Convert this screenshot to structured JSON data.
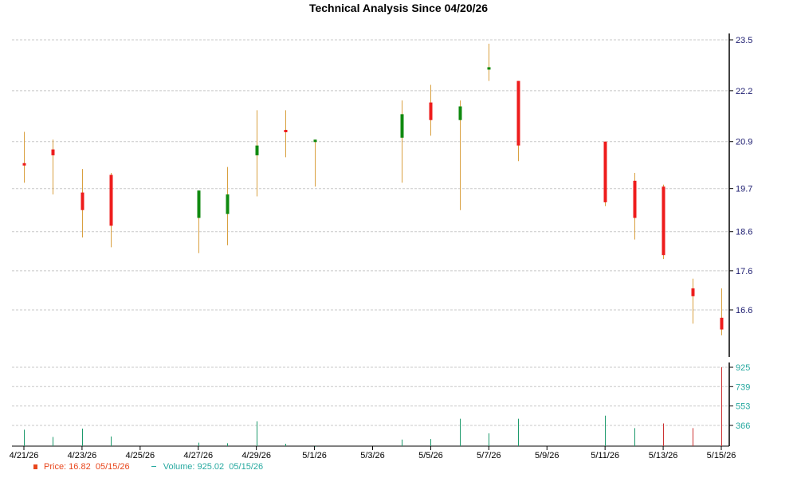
{
  "chart_data": {
    "type": "candlestick",
    "title": "Technical Analysis Since 04/20/26",
    "price_axis": {
      "ticks": [
        "23.5",
        "22.2",
        "20.9",
        "19.7",
        "18.6",
        "17.6",
        "16.6"
      ],
      "range": [
        15.8,
        23.5
      ]
    },
    "volume_axis": {
      "ticks": [
        "925",
        "739",
        "553",
        "366"
      ],
      "range": [
        160,
        925
      ]
    },
    "date_ticks": [
      "4/21/26",
      "4/23/26",
      "4/25/26",
      "4/27/26",
      "4/29/26",
      "5/1/26",
      "5/3/26",
      "5/5/26",
      "5/7/26",
      "5/9/26",
      "5/11/26",
      "5/13/26",
      "5/15/26"
    ],
    "colors": {
      "up": "#108a10",
      "down": "#ee1c1c",
      "wick": "#d9a040",
      "volume_up": "#1d9a6c",
      "volume_down": "#cc3333",
      "grid": "#c8c8c8",
      "axis": "#000000",
      "price_tick_text": "#1a1a6e",
      "volume_tick_text": "#27a9a0"
    },
    "grid": true,
    "candles": [
      {
        "date": "2026-04-21",
        "open": 20.35,
        "high": 21.15,
        "low": 19.85,
        "close": 20.3,
        "volume": 325
      },
      {
        "date": "2026-04-22",
        "open": 20.7,
        "high": 20.95,
        "low": 19.55,
        "close": 20.55,
        "volume": 255
      },
      {
        "date": "2026-04-23",
        "open": 19.6,
        "high": 20.2,
        "low": 18.45,
        "close": 19.15,
        "volume": 335
      },
      {
        "date": "2026-04-24",
        "open": 20.05,
        "high": 20.1,
        "low": 18.2,
        "close": 18.75,
        "volume": 260
      },
      {
        "date": "2026-04-27",
        "open": 18.95,
        "high": 19.65,
        "low": 18.05,
        "close": 19.65,
        "volume": 200
      },
      {
        "date": "2026-04-28",
        "open": 19.05,
        "high": 20.25,
        "low": 18.25,
        "close": 19.55,
        "volume": 195
      },
      {
        "date": "2026-04-29",
        "open": 20.55,
        "high": 21.7,
        "low": 19.5,
        "close": 20.8,
        "volume": 405
      },
      {
        "date": "2026-04-30",
        "open": 21.2,
        "high": 21.7,
        "low": 20.5,
        "close": 21.15,
        "volume": 190
      },
      {
        "date": "2026-05-01",
        "open": 20.95,
        "high": 20.95,
        "low": 19.75,
        "close": 20.95,
        "volume": 160
      },
      {
        "date": "2026-05-04",
        "open": 21.0,
        "high": 21.95,
        "low": 19.85,
        "close": 21.6,
        "volume": 230
      },
      {
        "date": "2026-05-05",
        "open": 21.9,
        "high": 22.35,
        "low": 21.05,
        "close": 21.45,
        "volume": 235
      },
      {
        "date": "2026-05-06",
        "open": 21.45,
        "high": 21.95,
        "low": 19.15,
        "close": 21.8,
        "volume": 430
      },
      {
        "date": "2026-05-07",
        "open": 22.75,
        "high": 23.4,
        "low": 22.45,
        "close": 22.8,
        "volume": 290
      },
      {
        "date": "2026-05-08",
        "open": 22.45,
        "high": 22.45,
        "low": 20.4,
        "close": 20.8,
        "volume": 430
      },
      {
        "date": "2026-05-11",
        "open": 20.9,
        "high": 20.9,
        "low": 19.25,
        "close": 19.35,
        "volume": 460
      },
      {
        "date": "2026-05-12",
        "open": 19.9,
        "high": 20.1,
        "low": 18.4,
        "close": 18.95,
        "volume": 340
      },
      {
        "date": "2026-05-13",
        "open": 19.75,
        "high": 19.8,
        "low": 17.9,
        "close": 18.0,
        "volume": 385,
        "down_volume": true
      },
      {
        "date": "2026-05-14",
        "open": 17.15,
        "high": 17.4,
        "low": 16.25,
        "close": 16.95,
        "volume": 340,
        "down_volume": true
      },
      {
        "date": "2026-05-15",
        "open": 16.4,
        "high": 17.15,
        "low": 15.95,
        "close": 16.1,
        "volume": 925,
        "down_volume": true
      }
    ]
  },
  "legend": {
    "price_label": "Price: 16.82",
    "price_date": "05/15/26",
    "volume_label": "Volume: 925.02",
    "volume_date": "05/15/26"
  }
}
